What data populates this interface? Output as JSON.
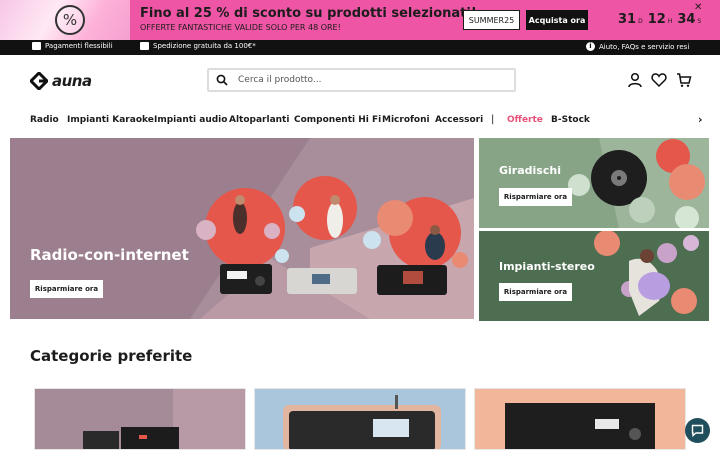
{
  "promo": {
    "title": "Fino al 25 % di sconto su prodotti selezionati!",
    "subtitle": "OFFERTE FANTASTICHE VALIDE SOLO PER 48 ORE!",
    "code": "SUMMER25",
    "cta": "Acquista ora",
    "timer": [
      {
        "value": "31",
        "unit": "D"
      },
      {
        "value": "12",
        "unit": "H"
      },
      {
        "value": "34",
        "unit": "S"
      }
    ],
    "badge_symbol": "%",
    "close": "✕"
  },
  "infobar": {
    "payments": "Pagamenti flessibili",
    "shipping": "Spedizione gratuita da 100€*",
    "help": "Aiuto, FAQs e servizio resi"
  },
  "header": {
    "logo": "auna",
    "search_placeholder": "Cerca il prodotto..."
  },
  "nav": {
    "items": [
      "Radio",
      "Impianti Karaoke",
      "Impianti audio",
      "Altoparlanti",
      "Componenti Hi Fi",
      "Microfoni",
      "Accessori"
    ],
    "separator": "|",
    "offers": "Offerte",
    "bstock": "B-Stock",
    "next": "›"
  },
  "hero": {
    "title": "Radio-con-internet",
    "cta": "Risparmiare ora"
  },
  "cards": [
    {
      "title": "Giradischi",
      "cta": "Risparmiare ora"
    },
    {
      "title": "Impianti-stereo",
      "cta": "Risparmiare ora"
    }
  ],
  "categories": {
    "title": "Categorie preferite"
  },
  "colors": {
    "promo_bg": "#ee55a4",
    "accent_offer": "#e8537a",
    "hero_bg": "#a58a97",
    "card_green_light": "#87a487",
    "card_green_dark": "#4d6e50",
    "chat_bg": "#1f4f5c"
  }
}
